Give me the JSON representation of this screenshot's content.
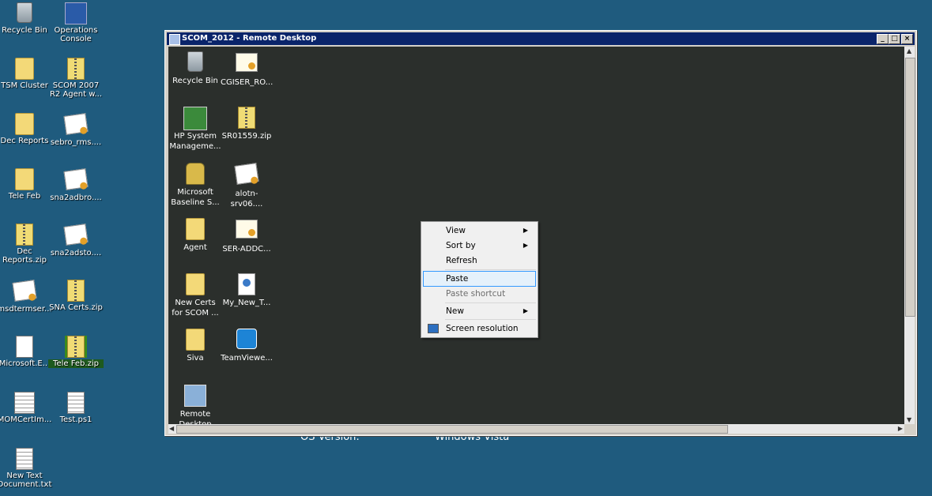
{
  "desktop": {
    "icons": [
      {
        "label": "Recycle Bin",
        "icon": "recycle-bin-icon"
      },
      {
        "label": "Operations Console",
        "icon": "operations-console-icon"
      },
      {
        "label": "TSM Cluster",
        "icon": "folder-icon"
      },
      {
        "label": "SCOM 2007 R2 Agent w...",
        "icon": "zip-folder-icon"
      },
      {
        "label": "Dec Reports",
        "icon": "folder-icon"
      },
      {
        "label": "sebro_rms....",
        "icon": "certificate-icon"
      },
      {
        "label": "Tele Feb",
        "icon": "folder-icon"
      },
      {
        "label": "sna2adbro....",
        "icon": "certificate-icon"
      },
      {
        "label": "Dec Reports.zip",
        "icon": "zip-folder-icon"
      },
      {
        "label": "sna2adsto....",
        "icon": "certificate-icon"
      },
      {
        "label": "msdtermser...",
        "icon": "certificate-icon"
      },
      {
        "label": "SNA Certs.zip",
        "icon": "zip-folder-icon"
      },
      {
        "label": "Microsoft.E...",
        "icon": "document-icon"
      },
      {
        "label": "Tele Feb.zip",
        "icon": "zip-folder-icon"
      },
      {
        "label": "MOMCertIm...",
        "icon": "program-icon"
      },
      {
        "label": "Test.ps1",
        "icon": "document-icon"
      },
      {
        "label": "New Text Document.txt",
        "icon": "text-document-icon"
      }
    ],
    "background_text": {
      "left": "OS Version:",
      "right": "Windows Vista"
    }
  },
  "window": {
    "title": "SCOM_2012 - Remote Desktop",
    "buttons": {
      "minimize": "_",
      "maximize": "□",
      "close": "×"
    }
  },
  "remote": {
    "icons": [
      {
        "label": "Recycle Bin",
        "icon": "recycle-bin-icon"
      },
      {
        "label": "CGISER_RO...",
        "icon": "certificate-icon"
      },
      {
        "label": "HP System Manageme...",
        "icon": "hp-system-management-icon"
      },
      {
        "label": "SR01559.zip",
        "icon": "zip-folder-icon"
      },
      {
        "label": "Microsoft Baseline S...",
        "icon": "baseline-security-icon"
      },
      {
        "label": "alotn-srv06....",
        "icon": "certificate-icon"
      },
      {
        "label": "Agent",
        "icon": "folder-icon"
      },
      {
        "label": "SER-ADDC...",
        "icon": "certificate-icon"
      },
      {
        "label": "New Certs for SCOM ...",
        "icon": "folder-icon"
      },
      {
        "label": "My_New_T...",
        "icon": "web-document-icon"
      },
      {
        "label": "Siva",
        "icon": "folder-icon"
      },
      {
        "label": "TeamViewe...",
        "icon": "teamviewer-icon"
      },
      {
        "label": "Remote Desktop",
        "icon": "remote-desktop-icon"
      }
    ]
  },
  "context_menu": {
    "items": [
      {
        "label": "View",
        "submenu": true
      },
      {
        "label": "Sort by",
        "submenu": true
      },
      {
        "label": "Refresh"
      },
      {
        "label": "Paste",
        "highlighted": true
      },
      {
        "label": "Paste shortcut",
        "disabled": true
      },
      {
        "label": "New",
        "submenu": true
      },
      {
        "label": "Screen resolution",
        "icon": "screen-resolution-icon"
      }
    ],
    "submenu_arrow": "▶"
  },
  "colors": {
    "desktop_bg": "#1f5b7e",
    "remote_bg": "#2b2f2c",
    "titlebar": "#0a246a",
    "menu_highlight": "#e5f1fb"
  }
}
